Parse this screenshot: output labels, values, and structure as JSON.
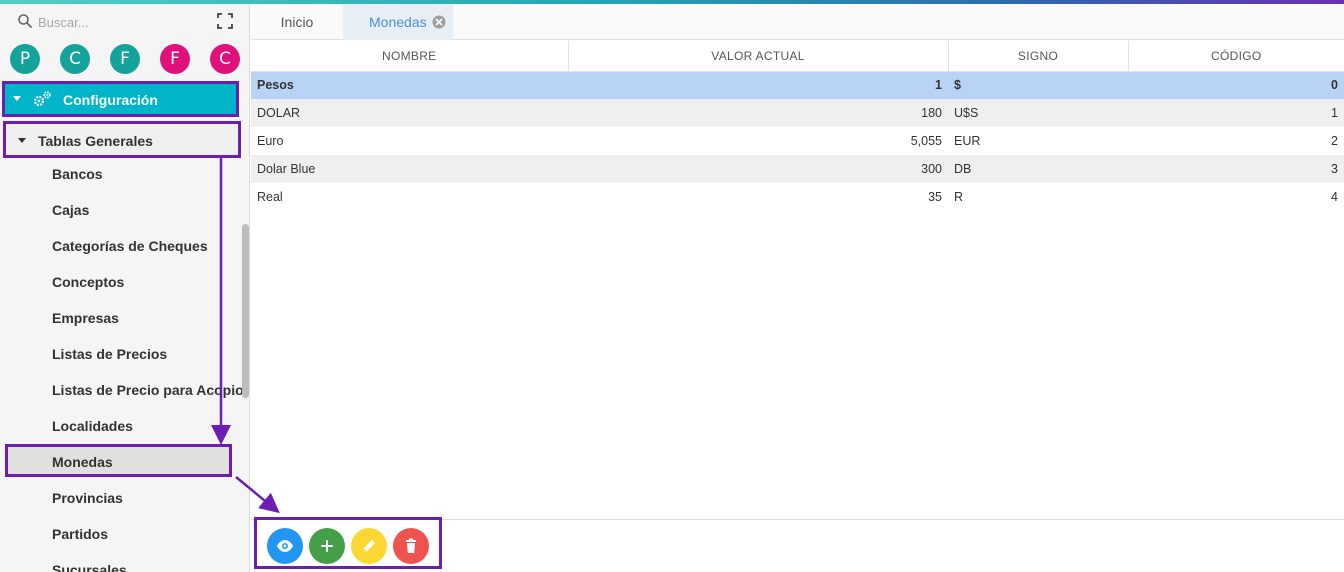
{
  "colors": {
    "accent": "#00b4c9",
    "highlight_border": "#6a1fb0",
    "selected_row": "#b8d3f5",
    "tab_active_text": "#4a90d9"
  },
  "search": {
    "placeholder": "Buscar..."
  },
  "avatars": [
    {
      "letter": "P",
      "color": "#14a39a"
    },
    {
      "letter": "C",
      "color": "#14a39a"
    },
    {
      "letter": "F",
      "color": "#14a39a"
    },
    {
      "letter": "F",
      "color": "#e0117a"
    },
    {
      "letter": "C",
      "color": "#e0117a"
    }
  ],
  "nav": {
    "config_label": "Configuración",
    "config_icon": "gears-icon",
    "tablas_label": "Tablas Generales",
    "items": [
      {
        "label": "Bancos"
      },
      {
        "label": "Cajas"
      },
      {
        "label": "Categorías de Cheques"
      },
      {
        "label": "Conceptos"
      },
      {
        "label": "Empresas"
      },
      {
        "label": "Listas de Precios"
      },
      {
        "label": "Listas de Precio para Acopio"
      },
      {
        "label": "Localidades"
      },
      {
        "label": "Monedas",
        "active": true
      },
      {
        "label": "Provincias"
      },
      {
        "label": "Partidos"
      },
      {
        "label": "Sucursales"
      }
    ]
  },
  "tabs": [
    {
      "label": "Inicio"
    },
    {
      "label": "Monedas",
      "active": true,
      "closable": true
    }
  ],
  "table": {
    "columns": [
      "NOMBRE",
      "VALOR ACTUAL",
      "SIGNO",
      "CÓDIGO"
    ],
    "rows": [
      {
        "nombre": "Pesos",
        "valor": "1",
        "signo": "$",
        "codigo": "0",
        "selected": true
      },
      {
        "nombre": "DOLAR",
        "valor": "180",
        "signo": "U$S",
        "codigo": "1"
      },
      {
        "nombre": "Euro",
        "valor": "5,055",
        "signo": "EUR",
        "codigo": "2"
      },
      {
        "nombre": "Dolar Blue",
        "valor": "300",
        "signo": "DB",
        "codigo": "3"
      },
      {
        "nombre": "Real",
        "valor": "35",
        "signo": "R",
        "codigo": "4"
      }
    ]
  },
  "actions": [
    {
      "name": "view-button",
      "icon": "eye-icon",
      "color": "#2196f3"
    },
    {
      "name": "add-button",
      "icon": "plus-icon",
      "color": "#43a047"
    },
    {
      "name": "edit-button",
      "icon": "pencil-icon",
      "color": "#fdd835"
    },
    {
      "name": "delete-button",
      "icon": "trash-icon",
      "color": "#ef5350"
    }
  ]
}
